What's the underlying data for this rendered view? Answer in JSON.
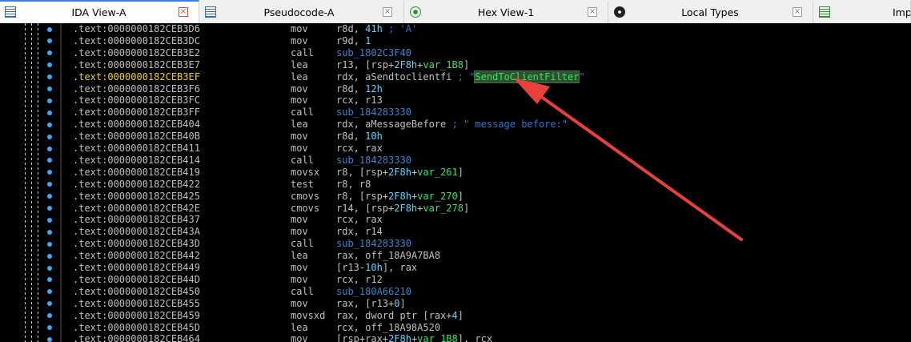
{
  "tabs": [
    {
      "label": "IDA View-A",
      "icon": "ida-view-icon",
      "active": true
    },
    {
      "label": "Pseudocode-A",
      "icon": "pseudocode-icon",
      "active": false
    },
    {
      "label": "Hex View-1",
      "icon": "hex-view-icon",
      "active": false
    },
    {
      "label": "Local Types",
      "icon": "local-types-icon",
      "active": false
    },
    {
      "label": "Imp",
      "icon": "imports-icon",
      "active": false
    }
  ],
  "close_glyph": "×",
  "colors": {
    "background": "#000000",
    "address": "#c0c0c0",
    "highlight_address": "#f2d600",
    "sub": "#3d84c8",
    "variable": "#2ee66a",
    "number": "#5fd7ff",
    "comment": "#2f74d0",
    "arrow": "#e8403a"
  },
  "lines": [
    {
      "addr": ".text:0000000182CEB3D6",
      "mnem": "mov",
      "ops": [
        {
          "t": "r8d",
          "c": "reg"
        },
        {
          "t": ", ",
          "c": "reg"
        },
        {
          "t": "41h",
          "c": "num"
        },
        {
          "t": " ; 'A'",
          "c": "cmt"
        }
      ]
    },
    {
      "addr": ".text:0000000182CEB3DC",
      "mnem": "mov",
      "ops": [
        {
          "t": "r9d",
          "c": "reg"
        },
        {
          "t": ", ",
          "c": "reg"
        },
        {
          "t": "1",
          "c": "num"
        }
      ]
    },
    {
      "addr": ".text:0000000182CEB3E2",
      "mnem": "call",
      "ops": [
        {
          "t": "sub_1802C3F40",
          "c": "sub"
        }
      ]
    },
    {
      "addr": ".text:0000000182CEB3E7",
      "mnem": "lea",
      "ops": [
        {
          "t": "r13, [rsp+",
          "c": "reg"
        },
        {
          "t": "2F8h",
          "c": "num"
        },
        {
          "t": "+",
          "c": "reg"
        },
        {
          "t": "var_1B8",
          "c": "var"
        },
        {
          "t": "]",
          "c": "reg"
        }
      ]
    },
    {
      "addr": ".text:0000000182CEB3EF",
      "mnem": "lea",
      "hl": true,
      "ops": [
        {
          "t": "rdx, aSendtoclientfi",
          "c": "reg"
        },
        {
          "t": " ; ",
          "c": "cmt"
        },
        {
          "t": "\"",
          "c": "cmt"
        },
        {
          "t": "SendToClientFilter",
          "c": "hlstr"
        },
        {
          "t": "\"",
          "c": "cmt"
        }
      ]
    },
    {
      "addr": ".text:0000000182CEB3F6",
      "mnem": "mov",
      "ops": [
        {
          "t": "r8d, ",
          "c": "reg"
        },
        {
          "t": "12h",
          "c": "num"
        }
      ]
    },
    {
      "addr": ".text:0000000182CEB3FC",
      "mnem": "mov",
      "ops": [
        {
          "t": "rcx, r13",
          "c": "reg"
        }
      ]
    },
    {
      "addr": ".text:0000000182CEB3FF",
      "mnem": "call",
      "ops": [
        {
          "t": "sub_184283330",
          "c": "sub"
        }
      ]
    },
    {
      "addr": ".text:0000000182CEB404",
      "mnem": "lea",
      "ops": [
        {
          "t": "rdx, aMessageBefore",
          "c": "reg"
        },
        {
          "t": " ; \" message before:\"",
          "c": "cmt"
        }
      ]
    },
    {
      "addr": ".text:0000000182CEB40B",
      "mnem": "mov",
      "ops": [
        {
          "t": "r8d, ",
          "c": "reg"
        },
        {
          "t": "10h",
          "c": "num"
        }
      ]
    },
    {
      "addr": ".text:0000000182CEB411",
      "mnem": "mov",
      "ops": [
        {
          "t": "rcx, rax",
          "c": "reg"
        }
      ]
    },
    {
      "addr": ".text:0000000182CEB414",
      "mnem": "call",
      "ops": [
        {
          "t": "sub_184283330",
          "c": "sub"
        }
      ]
    },
    {
      "addr": ".text:0000000182CEB419",
      "mnem": "movsx",
      "ops": [
        {
          "t": "r8, [rsp+",
          "c": "reg"
        },
        {
          "t": "2F8h",
          "c": "num"
        },
        {
          "t": "+",
          "c": "reg"
        },
        {
          "t": "var_261",
          "c": "var"
        },
        {
          "t": "]",
          "c": "reg"
        }
      ]
    },
    {
      "addr": ".text:0000000182CEB422",
      "mnem": "test",
      "ops": [
        {
          "t": "r8, r8",
          "c": "reg"
        }
      ]
    },
    {
      "addr": ".text:0000000182CEB425",
      "mnem": "cmovs",
      "ops": [
        {
          "t": "r8, [rsp+",
          "c": "reg"
        },
        {
          "t": "2F8h",
          "c": "num"
        },
        {
          "t": "+",
          "c": "reg"
        },
        {
          "t": "var_270",
          "c": "var"
        },
        {
          "t": "]",
          "c": "reg"
        }
      ]
    },
    {
      "addr": ".text:0000000182CEB42E",
      "mnem": "cmovs",
      "ops": [
        {
          "t": "r14, [rsp+",
          "c": "reg"
        },
        {
          "t": "2F8h",
          "c": "num"
        },
        {
          "t": "+",
          "c": "reg"
        },
        {
          "t": "var_278",
          "c": "var"
        },
        {
          "t": "]",
          "c": "reg"
        }
      ]
    },
    {
      "addr": ".text:0000000182CEB437",
      "mnem": "mov",
      "ops": [
        {
          "t": "rcx, rax",
          "c": "reg"
        }
      ]
    },
    {
      "addr": ".text:0000000182CEB43A",
      "mnem": "mov",
      "ops": [
        {
          "t": "rdx, r14",
          "c": "reg"
        }
      ]
    },
    {
      "addr": ".text:0000000182CEB43D",
      "mnem": "call",
      "ops": [
        {
          "t": "sub_184283330",
          "c": "sub"
        }
      ]
    },
    {
      "addr": ".text:0000000182CEB442",
      "mnem": "lea",
      "ops": [
        {
          "t": "rax, off_18A9A7BA8",
          "c": "lbl"
        }
      ]
    },
    {
      "addr": ".text:0000000182CEB449",
      "mnem": "mov",
      "ops": [
        {
          "t": "[r13-",
          "c": "reg"
        },
        {
          "t": "10h",
          "c": "num"
        },
        {
          "t": "], rax",
          "c": "reg"
        }
      ]
    },
    {
      "addr": ".text:0000000182CEB44D",
      "mnem": "mov",
      "ops": [
        {
          "t": "rcx, r12",
          "c": "reg"
        }
      ]
    },
    {
      "addr": ".text:0000000182CEB450",
      "mnem": "call",
      "ops": [
        {
          "t": "sub_180A66210",
          "c": "sub"
        }
      ]
    },
    {
      "addr": ".text:0000000182CEB455",
      "mnem": "mov",
      "ops": [
        {
          "t": "rax, [r13+",
          "c": "reg"
        },
        {
          "t": "0",
          "c": "num"
        },
        {
          "t": "]",
          "c": "reg"
        }
      ]
    },
    {
      "addr": ".text:0000000182CEB459",
      "mnem": "movsxd",
      "ops": [
        {
          "t": "rax, dword ptr [rax+",
          "c": "reg"
        },
        {
          "t": "4",
          "c": "num"
        },
        {
          "t": "]",
          "c": "reg"
        }
      ]
    },
    {
      "addr": ".text:0000000182CEB45D",
      "mnem": "lea",
      "ops": [
        {
          "t": "rcx, off_18A98A520",
          "c": "lbl"
        }
      ]
    },
    {
      "addr": ".text:0000000182CEB464",
      "mnem": "mov",
      "ops": [
        {
          "t": "[rsp+rax+",
          "c": "reg"
        },
        {
          "t": "2F8h",
          "c": "num"
        },
        {
          "t": "+",
          "c": "reg"
        },
        {
          "t": "var_1B8",
          "c": "var"
        },
        {
          "t": "], rcx",
          "c": "reg"
        }
      ]
    }
  ]
}
